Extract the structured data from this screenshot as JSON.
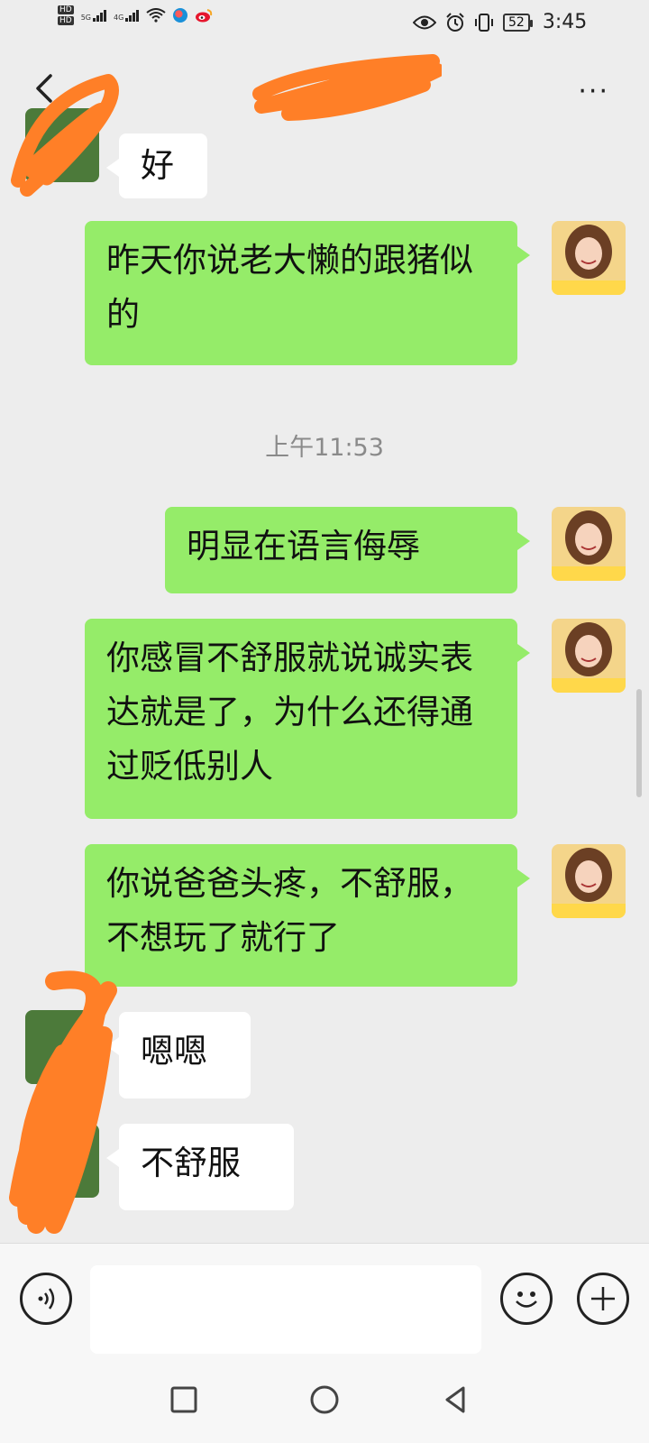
{
  "status_bar": {
    "hd_badges": [
      "HD",
      "HD"
    ],
    "network_1": "5G",
    "network_2": "4G",
    "battery": "52",
    "time": "3:45"
  },
  "header": {
    "more_label": "···"
  },
  "messages": [
    {
      "side": "other",
      "text": "好"
    },
    {
      "side": "mine",
      "text": "昨天你说老大懒的跟猪似的"
    },
    {
      "type": "time",
      "text": "上午11:53"
    },
    {
      "side": "mine",
      "text": "明显在语言侮辱"
    },
    {
      "side": "mine",
      "text": "你感冒不舒服就说诚实表达就是了，为什么还得通过贬低别人"
    },
    {
      "side": "mine",
      "text": "你说爸爸头疼，不舒服，不想玩了就行了"
    },
    {
      "side": "other",
      "text": "嗯嗯"
    },
    {
      "side": "other",
      "text": "不舒服"
    }
  ],
  "colors": {
    "background": "#ededed",
    "my_bubble": "#95ec69",
    "other_bubble": "#ffffff",
    "redaction": "#ff7f27"
  },
  "icons": {
    "back": "chevron-left-icon",
    "more": "more-dots-icon",
    "voice": "voice-icon",
    "emoji": "emoji-icon",
    "add": "plus-icon",
    "nav_recent": "square-icon",
    "nav_home": "circle-icon",
    "nav_back": "triangle-back-icon"
  }
}
